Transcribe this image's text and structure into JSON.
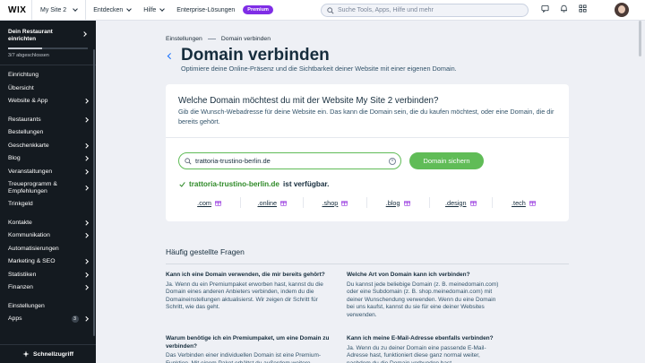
{
  "topbar": {
    "logo": "WIX",
    "site_name": "My Site 2",
    "menu": [
      "Entdecken",
      "Hilfe"
    ],
    "enterprise": "Enterprise-Lösungen",
    "premium": "Premium",
    "search_placeholder": "Suche Tools, Apps, Hilfe und mehr"
  },
  "sidebar": {
    "setup_title": "Dein Restaurant einrichten",
    "progress_text": "3/7 abgeschlossen",
    "progress_fraction": 0.43,
    "group1": [
      {
        "label": "Einrichtung",
        "chevron": false
      },
      {
        "label": "Übersicht",
        "chevron": false
      },
      {
        "label": "Website & App",
        "chevron": true
      }
    ],
    "group2": [
      {
        "label": "Restaurants",
        "chevron": true
      },
      {
        "label": "Bestellungen",
        "chevron": false
      },
      {
        "label": "Geschenkkarte",
        "chevron": true
      },
      {
        "label": "Blog",
        "chevron": true
      },
      {
        "label": "Veranstaltungen",
        "chevron": true
      },
      {
        "label": "Treueprogramm & Empfehlungen",
        "chevron": true
      },
      {
        "label": "Trinkgeld",
        "chevron": false
      }
    ],
    "group3": [
      {
        "label": "Kontakte",
        "chevron": true
      },
      {
        "label": "Kommunikation",
        "chevron": true
      },
      {
        "label": "Automatisierungen",
        "chevron": false
      },
      {
        "label": "Marketing & SEO",
        "chevron": true
      },
      {
        "label": "Statistiken",
        "chevron": true
      },
      {
        "label": "Finanzen",
        "chevron": true
      }
    ],
    "group4": [
      {
        "label": "Einstellungen",
        "chevron": false
      },
      {
        "label": "Apps",
        "chevron": true,
        "badge": "3"
      }
    ],
    "quick_access": "Schnellzugriff"
  },
  "main": {
    "breadcrumb": [
      "Einstellungen",
      "Domain verbinden"
    ],
    "title": "Domain verbinden",
    "subtitle": "Optimiere deine Online-Präsenz und die Sichtbarkeit deiner Website mit einer eigenen Domain.",
    "card": {
      "title": "Welche Domain möchtest du mit der Website My Site 2 verbinden?",
      "description": "Gib die Wunsch-Webadresse für deine Website ein. Das kann die Domain sein, die du kaufen möchtest, oder eine Domain, die dir bereits gehört.",
      "input_value": "trattoria-trustino-berlin.de",
      "button": "Domain sichern",
      "available_domain": "trattoria-trustino-berlin.de",
      "available_text": "ist verfügbar.",
      "tlds": [
        ".com",
        ".online",
        ".shop",
        ".blog",
        ".design",
        ".tech"
      ]
    },
    "faq_title": "Häufig gestellte Fragen",
    "faqs": [
      {
        "q": "Kann ich eine Domain verwenden, die mir bereits gehört?",
        "a": "Ja. Wenn du ein Premiumpaket erworben hast, kannst du die Domain eines anderen Anbieters verbinden, indem du die Domaineinstellungen aktualisierst. Wir zeigen dir Schritt für Schritt, wie das geht."
      },
      {
        "q": "Welche Art von Domain kann ich verbinden?",
        "a": "Du kannst jede beliebige Domain (z. B. meinedomain.com) oder eine Subdomain (z. B. shop.meinedomain.com) mit deiner Wunschendung verwenden. Wenn du eine Domain bei uns kaufst, kannst du sie für eine deiner Websites verwenden."
      },
      {
        "q": "Warum benötige ich ein Premiumpaket, um eine Domain zu verbinden?",
        "a": "Das Verbinden einer individuellen Domain ist eine Premium-Funktion. Mit einem Paket erhältst du außerdem weitere Funktionen."
      },
      {
        "q": "Kann ich meine E-Mail-Adresse ebenfalls verbinden?",
        "a": "Ja. Wenn du zu deiner Domain eine passende E-Mail-Adresse hast, funktioniert diese ganz normal weiter, nachdem du die Domain verbunden hast."
      }
    ]
  }
}
